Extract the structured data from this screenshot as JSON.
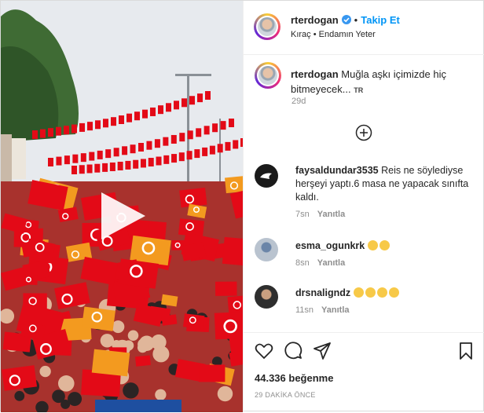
{
  "post": {
    "author": "rterdogan",
    "follow_label": "Takip Et",
    "audio": "Kıraç • Endamın Yeter",
    "caption_author": "rterdogan",
    "caption": "Muğla aşkı içimizde hiç bitmeyecek...",
    "caption_lang": "TR",
    "caption_time": "29d",
    "likes": "44.336 beğenme",
    "posted": "29 DAKİKA ÖNCE"
  },
  "comments": [
    {
      "user": "faysaldundar3535",
      "text": "Reis ne söylediyse herşeyi yaptı.6 masa ne yapacak sınıfta kaldı.",
      "time": "7sn",
      "reply": "Yanıtla"
    },
    {
      "user": "esma_ogunkrk",
      "text": "",
      "time": "8sn",
      "reply": "Yanıtla",
      "emojis": 2
    },
    {
      "user": "drsnaligndz",
      "text": "",
      "time": "11sn",
      "reply": "Yanıtla",
      "emojis": 4
    }
  ],
  "icons": {
    "play": "play-icon",
    "verified": "verified-icon",
    "add": "add-comment-icon",
    "like": "heart-icon",
    "comment": "comment-icon",
    "share": "share-icon",
    "save": "bookmark-icon"
  },
  "colors": {
    "accent": "#0095f6",
    "flag_red": "#e30a17",
    "flag_orange": "#f39a1f"
  }
}
